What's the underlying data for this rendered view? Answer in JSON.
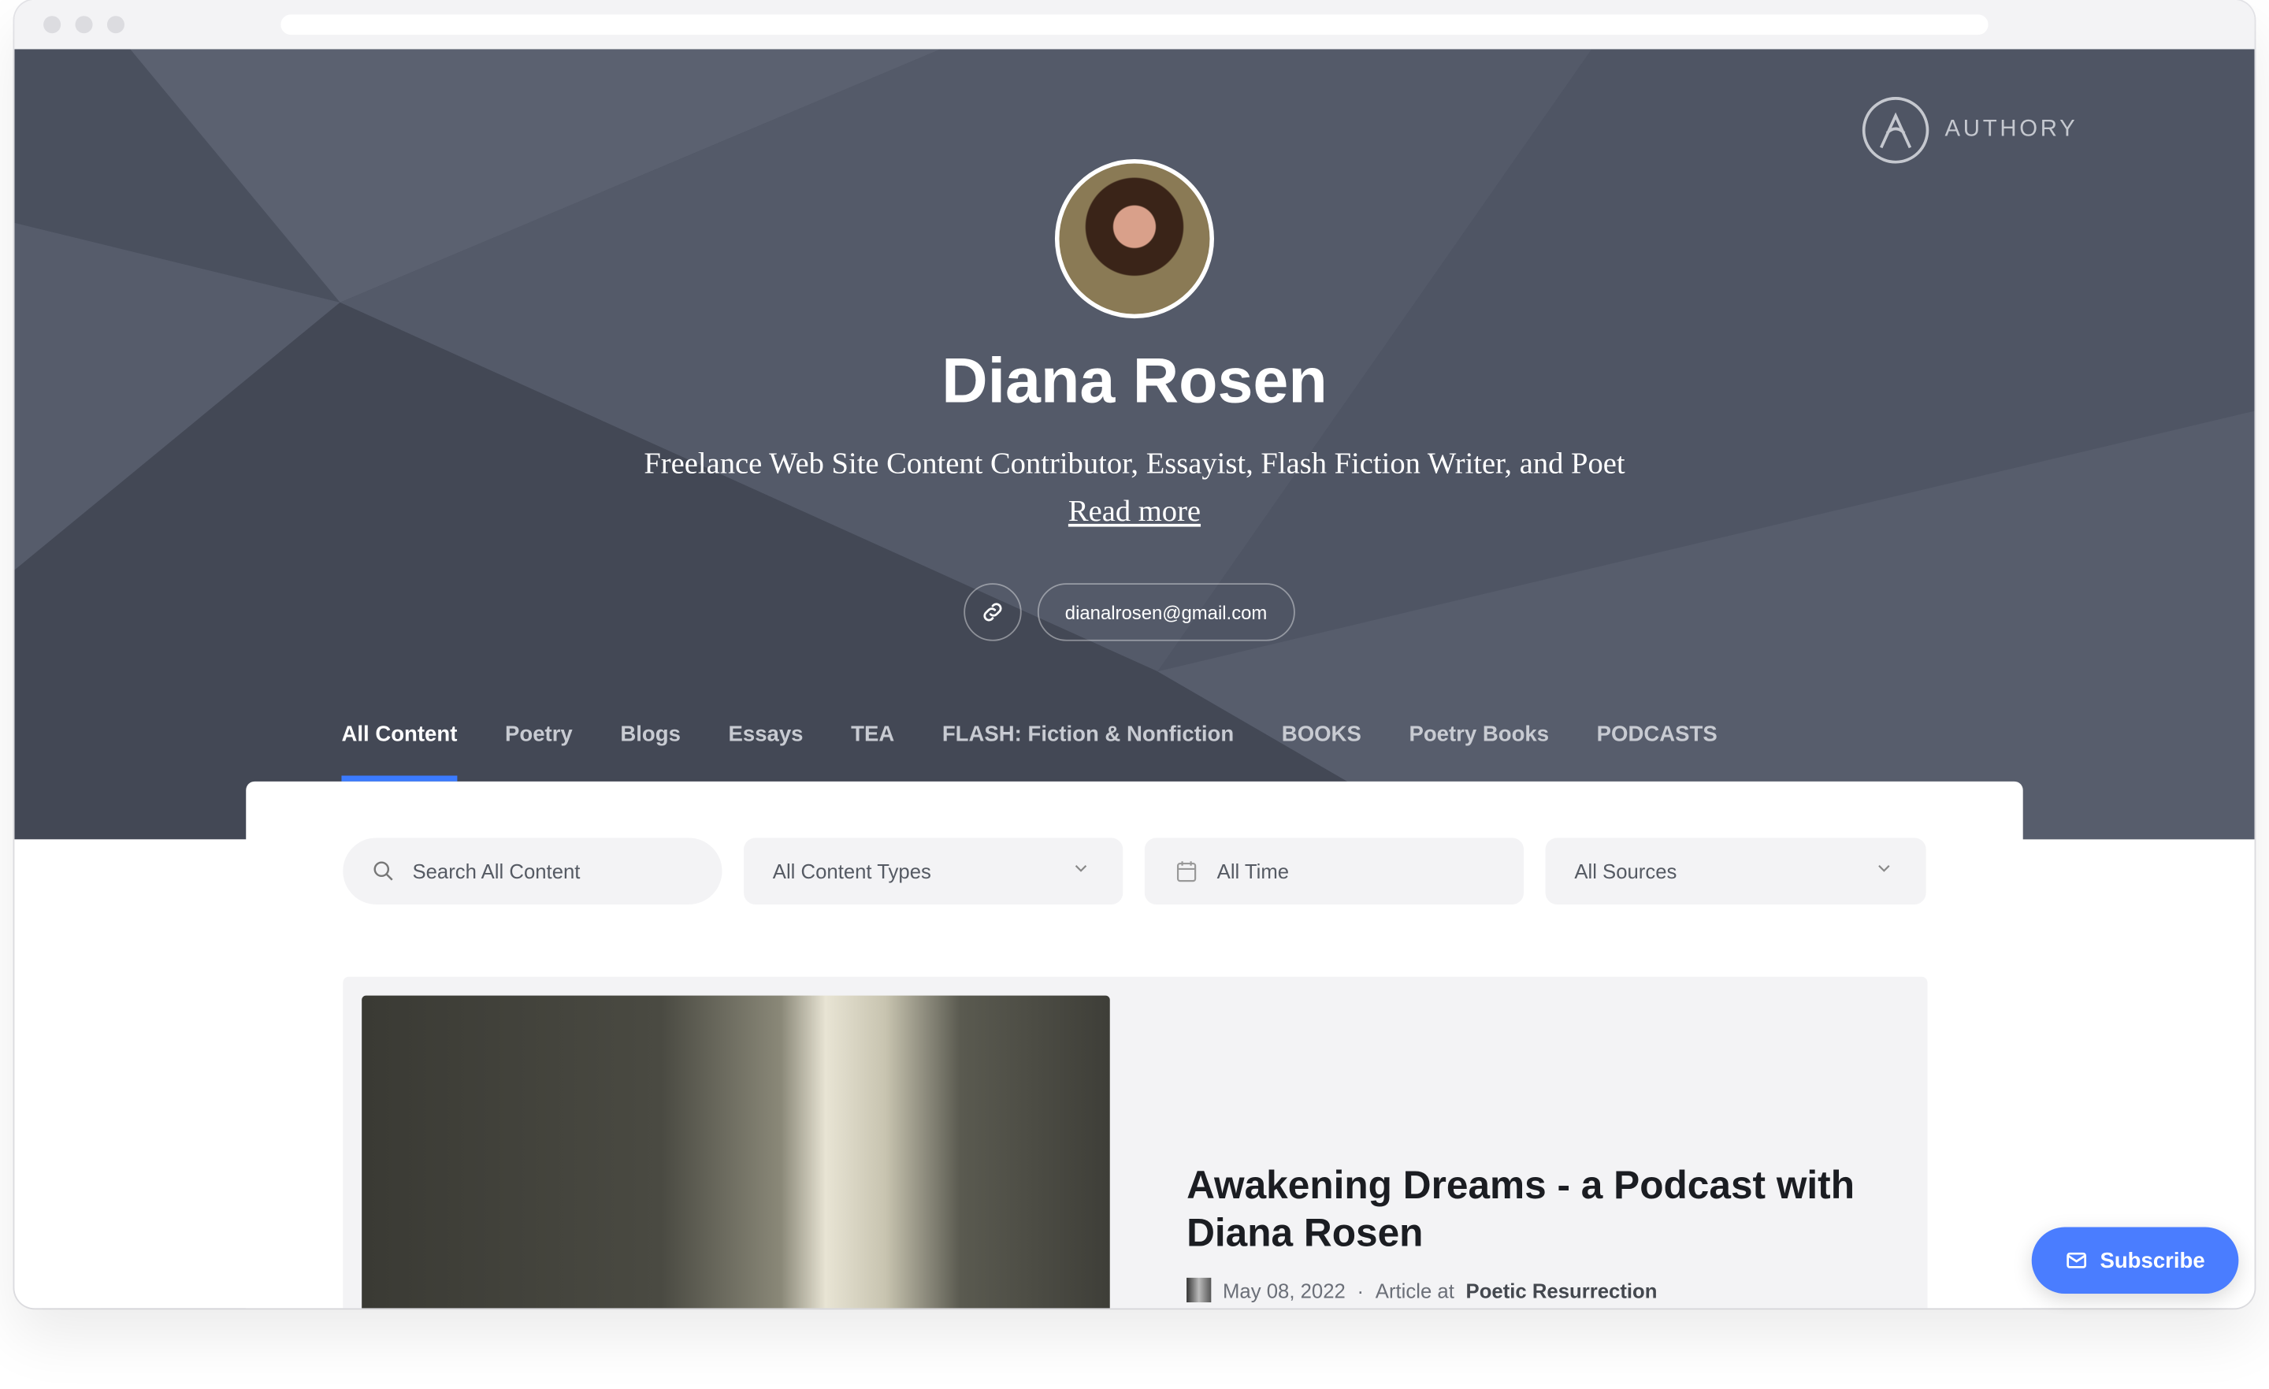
{
  "brand": {
    "name": "AUTHORY"
  },
  "profile": {
    "name": "Diana Rosen",
    "bio": "Freelance Web Site Content Contributor, Essayist, Flash Fiction Writer, and Poet",
    "read_more": "Read more",
    "email": "dianalrosen@gmail.com"
  },
  "tabs": [
    {
      "label": "All Content",
      "active": true
    },
    {
      "label": "Poetry"
    },
    {
      "label": "Blogs"
    },
    {
      "label": "Essays"
    },
    {
      "label": "TEA"
    },
    {
      "label": "FLASH: Fiction & Nonfiction"
    },
    {
      "label": "BOOKS"
    },
    {
      "label": "Poetry Books"
    },
    {
      "label": "PODCASTS"
    }
  ],
  "filters": {
    "search_placeholder": "Search All Content",
    "content_types": "All Content Types",
    "time": "All Time",
    "sources": "All Sources"
  },
  "post": {
    "title": "Awakening Dreams - a Podcast with Diana Rosen",
    "date": "May 08, 2022",
    "separator": "·",
    "type_prefix": "Article at",
    "source": "Poetic Resurrection"
  },
  "subscribe": {
    "label": "Subscribe"
  },
  "colors": {
    "accent": "#4a7dff",
    "hero": "#4a505e"
  }
}
